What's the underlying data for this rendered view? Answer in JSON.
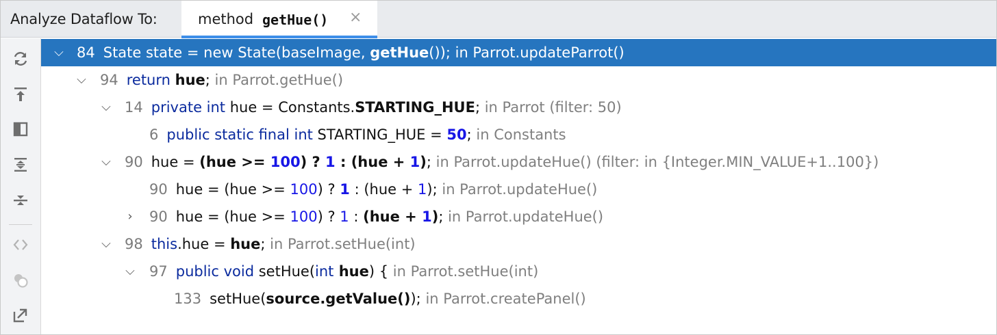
{
  "header": {
    "title": "Analyze Dataflow To:",
    "tab_prefix": "method",
    "tab_method": "getHue()",
    "tab_close": "×"
  },
  "toolbar": {
    "icons": [
      "refresh-icon",
      "export-icon",
      "preview-panel-icon",
      "expand-all-icon",
      "collapse-all-icon",
      "code-brackets-icon",
      "group-icon",
      "navigate-out-icon"
    ]
  },
  "tree": {
    "rows": [
      {
        "ln": "84",
        "t1": "State state = new State(baseImage, ",
        "t2": "getHue",
        "t3": "()); in Parrot.updateParrot()"
      },
      {
        "ln": "94",
        "kw": "return",
        "b": "hue",
        "rest": ";",
        "ctx": " in Parrot.getHue()"
      },
      {
        "ln": "14",
        "kw": "private int",
        "t1": " hue = Constants.",
        "b": "STARTING_HUE",
        "rest": ";",
        "ctx": " in Parrot (filter: 50)"
      },
      {
        "ln": "6",
        "kw": "public static final int",
        "t1": " STARTING_HUE = ",
        "num": "50",
        "rest": ";",
        "ctx": " in Constants"
      },
      {
        "ln": "90",
        "t1": "hue = ",
        "b1": "(hue >= ",
        "n1": "100",
        "b2": ") ? ",
        "n2": "1",
        "b3": " : (hue + ",
        "n3": "1",
        "b4": ")",
        "rest": ";",
        "ctx": " in Parrot.updateHue()  (filter: in {Integer.MIN_VALUE+1..100})"
      },
      {
        "ln": "90",
        "t1": "hue = (hue >= ",
        "n1": "100",
        "t2": ") ? ",
        "n2": "1",
        "t3": " : (hue + ",
        "n3": "1",
        "t4": ");",
        "ctx": " in Parrot.updateHue()"
      },
      {
        "ln": "90",
        "t1": "hue = (hue >= ",
        "n1": "100",
        "t2": ") ? ",
        "n2": "1",
        "t3": " : ",
        "b": "(hue + ",
        "n3": "1",
        "b2": ")",
        "t4": ";",
        "ctx": " in Parrot.updateHue()"
      },
      {
        "ln": "98",
        "kw": "this",
        "t1": ".hue = ",
        "b": "hue",
        "rest": ";",
        "ctx": " in Parrot.setHue(int)"
      },
      {
        "ln": "97",
        "kw": "public void",
        "t1": " setHue(",
        "kw2": "int",
        "b": " hue",
        "t2": ") {",
        "ctx": " in Parrot.setHue(int)"
      },
      {
        "ln": "133",
        "t1": "setHue(",
        "b": "source.getValue()",
        "t2": ");",
        "ctx": " in Parrot.createPanel()"
      }
    ]
  }
}
